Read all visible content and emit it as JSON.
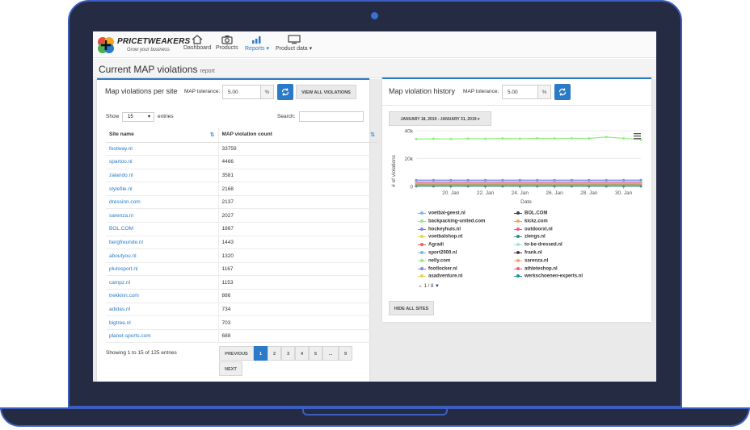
{
  "app": {
    "brand": "PRICETWEAKERS",
    "tagline": "Grow your business",
    "nav": [
      {
        "label": "Dashboard",
        "icon": "home-icon"
      },
      {
        "label": "Products",
        "icon": "camera-icon"
      },
      {
        "label": "Reports ▾",
        "icon": "bar-chart-icon"
      },
      {
        "label": "Product data ▾",
        "icon": "monitor-icon"
      }
    ]
  },
  "page": {
    "title": "Current MAP violations",
    "subtitle": "report"
  },
  "left_panel": {
    "title": "Map violations per site",
    "tolerance_label": "MAP tolerance:",
    "tolerance_value": "5.00",
    "tolerance_unit": "%",
    "view_all_label": "VIEW ALL VIOLATIONS",
    "show_label": "Show",
    "entries_value": "15",
    "entries_label": "entries",
    "search_label": "Search:",
    "columns": [
      "Site name",
      "MAP violation count"
    ],
    "rows": [
      {
        "site": "footway.nl",
        "count": "33759"
      },
      {
        "site": "spartoo.nl",
        "count": "4466"
      },
      {
        "site": "zalando.nl",
        "count": "3581"
      },
      {
        "site": "stylefile.nl",
        "count": "2168"
      },
      {
        "site": "dressinn.com",
        "count": "2137"
      },
      {
        "site": "sarenza.nl",
        "count": "2027"
      },
      {
        "site": "BOL.COM",
        "count": "1867"
      },
      {
        "site": "bergfreunde.nl",
        "count": "1443"
      },
      {
        "site": "aboutyou.nl",
        "count": "1320"
      },
      {
        "site": "plutosport.nl",
        "count": "1167"
      },
      {
        "site": "campz.nl",
        "count": "1153"
      },
      {
        "site": "trekkinn.com",
        "count": "886"
      },
      {
        "site": "adidas.nl",
        "count": "734"
      },
      {
        "site": "bigtree.nl",
        "count": "703"
      },
      {
        "site": "planet-sports.com",
        "count": "688"
      }
    ],
    "info": "Showing 1 to 15 of 125 entries",
    "pager": {
      "previous": "PREVIOUS",
      "pages": [
        "1",
        "2",
        "3",
        "4",
        "5",
        "...",
        "9"
      ],
      "next": "NEXT"
    }
  },
  "right_panel": {
    "title": "Map violation history",
    "tolerance_label": "MAP tolerance:",
    "tolerance_value": "5.00",
    "tolerance_unit": "%",
    "date_range": "JANUARY 18, 2019 - JANUARY 31, 2019 ▾",
    "legend_pager": "1 / 8",
    "hide_all_label": "HIDE ALL SITES"
  },
  "chart_data": {
    "type": "line",
    "title": "",
    "xlabel": "Date",
    "ylabel": "# of violations",
    "y_ticks": [
      "0",
      "20k",
      "40k"
    ],
    "ylim": [
      0,
      40000
    ],
    "x_ticks": [
      "20. Jan",
      "22. Jan",
      "24. Jan",
      "26. Jan",
      "28. Jan",
      "30. Jan"
    ],
    "x": [
      "18. Jan",
      "19. Jan",
      "20. Jan",
      "21. Jan",
      "22. Jan",
      "23. Jan",
      "24. Jan",
      "25. Jan",
      "26. Jan",
      "27. Jan",
      "28. Jan",
      "29. Jan",
      "30. Jan",
      "31. Jan"
    ],
    "grid": true,
    "series": [
      {
        "name": "voetbal-geest.nl",
        "color": "#7cb5ec",
        "values": [
          1500,
          1500,
          1500,
          1500,
          1500,
          1500,
          1500,
          1500,
          1500,
          1500,
          1500,
          1500,
          1500,
          1500
        ]
      },
      {
        "name": "BOL.COM",
        "color": "#434348",
        "values": [
          1867,
          1867,
          1867,
          1867,
          1867,
          1867,
          1867,
          1867,
          1867,
          1867,
          1867,
          1867,
          1867,
          1867
        ]
      },
      {
        "name": "backpacking-united.com",
        "color": "#90ed7d",
        "values": [
          34000,
          34200,
          34100,
          34300,
          34200,
          34400,
          34300,
          34500,
          34400,
          34600,
          34500,
          35500,
          34500,
          33500
        ]
      },
      {
        "name": "kickz.com",
        "color": "#f7a35c",
        "values": [
          300,
          300,
          300,
          300,
          300,
          300,
          300,
          300,
          300,
          300,
          300,
          300,
          300,
          300
        ]
      },
      {
        "name": "hockeyhuis.nl",
        "color": "#8085e9",
        "values": [
          4500,
          4500,
          4500,
          4500,
          4500,
          4500,
          4500,
          4500,
          4500,
          4500,
          4500,
          4500,
          4500,
          4500
        ]
      },
      {
        "name": "outdoorxl.nl",
        "color": "#f15c80",
        "values": [
          2500,
          2500,
          2500,
          2500,
          2500,
          2500,
          2500,
          2500,
          2500,
          2500,
          2500,
          2500,
          2500,
          2500
        ]
      },
      {
        "name": "voetbalshop.nl",
        "color": "#e4d354",
        "values": [
          200,
          200,
          200,
          200,
          200,
          200,
          200,
          200,
          200,
          200,
          200,
          200,
          200,
          200
        ]
      },
      {
        "name": "ziengs.nl",
        "color": "#2b908f",
        "values": [
          600,
          600,
          600,
          600,
          600,
          600,
          600,
          600,
          600,
          600,
          600,
          600,
          600,
          600
        ]
      },
      {
        "name": "Agradi",
        "color": "#f45b5b",
        "values": [
          800,
          800,
          800,
          800,
          800,
          800,
          800,
          800,
          800,
          800,
          800,
          800,
          800,
          800
        ]
      },
      {
        "name": "to-be-dressed.nl",
        "color": "#91e8e1",
        "values": [
          400,
          400,
          400,
          400,
          400,
          400,
          400,
          400,
          400,
          400,
          400,
          400,
          400,
          400
        ]
      },
      {
        "name": "sport2000.nl",
        "color": "#7cb5ec",
        "values": [
          3500,
          3500,
          3500,
          3500,
          3500,
          3500,
          3500,
          3500,
          3500,
          3500,
          3500,
          3500,
          3500,
          3500
        ]
      },
      {
        "name": "frank.nl",
        "color": "#434348",
        "values": [
          1000,
          1000,
          1000,
          1000,
          1000,
          1000,
          1000,
          1000,
          1000,
          1000,
          1000,
          1000,
          1000,
          1000
        ]
      },
      {
        "name": "nelly.com",
        "color": "#90ed7d",
        "values": [
          1200,
          1200,
          1200,
          1200,
          1200,
          1200,
          1200,
          1200,
          1200,
          1200,
          1200,
          1200,
          1200,
          1200
        ]
      },
      {
        "name": "sarenza.nl",
        "color": "#f7a35c",
        "values": [
          2027,
          2027,
          2027,
          2027,
          2027,
          2027,
          2027,
          2027,
          2027,
          2027,
          2027,
          2027,
          2027,
          2027
        ]
      },
      {
        "name": "footlocker.nl",
        "color": "#8085e9",
        "values": [
          700,
          700,
          700,
          700,
          700,
          700,
          700,
          700,
          700,
          700,
          700,
          700,
          700,
          700
        ]
      },
      {
        "name": "athleteshop.nl",
        "color": "#f15c80",
        "values": [
          900,
          900,
          900,
          900,
          900,
          900,
          900,
          900,
          900,
          900,
          900,
          900,
          900,
          900
        ]
      },
      {
        "name": "asadventure.nl",
        "color": "#e4d354",
        "values": [
          500,
          500,
          500,
          500,
          500,
          500,
          500,
          500,
          500,
          500,
          500,
          500,
          500,
          500
        ]
      },
      {
        "name": "werkschoenen-experts.nl",
        "color": "#2b908f",
        "values": [
          100,
          100,
          100,
          100,
          100,
          100,
          100,
          100,
          100,
          100,
          100,
          100,
          100,
          100
        ]
      }
    ]
  }
}
